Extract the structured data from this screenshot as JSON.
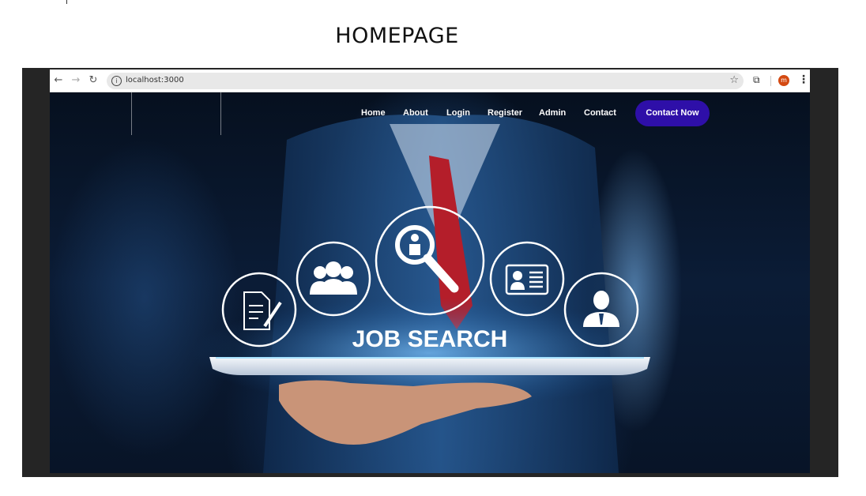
{
  "page_heading": "HOMEPAGE",
  "browser": {
    "url": "localhost:3000",
    "profile_initial": "m",
    "icons": [
      "back-arrow-icon",
      "forward-arrow-icon",
      "reload-icon",
      "info-icon",
      "star-icon",
      "extensions-icon",
      "menu-dots-icon"
    ]
  },
  "nav": {
    "items": [
      {
        "label": "Home"
      },
      {
        "label": "About"
      },
      {
        "label": "Login"
      },
      {
        "label": "Register"
      },
      {
        "label": "Admin"
      },
      {
        "label": "Contact"
      }
    ],
    "cta_label": "Contact Now",
    "cta_color": "#2e0fa8"
  },
  "hero": {
    "headline": "JOB SEARCH",
    "icons": [
      "document-pen-icon",
      "group-icon",
      "magnifier-person-icon",
      "id-card-icon",
      "businessman-icon"
    ]
  }
}
